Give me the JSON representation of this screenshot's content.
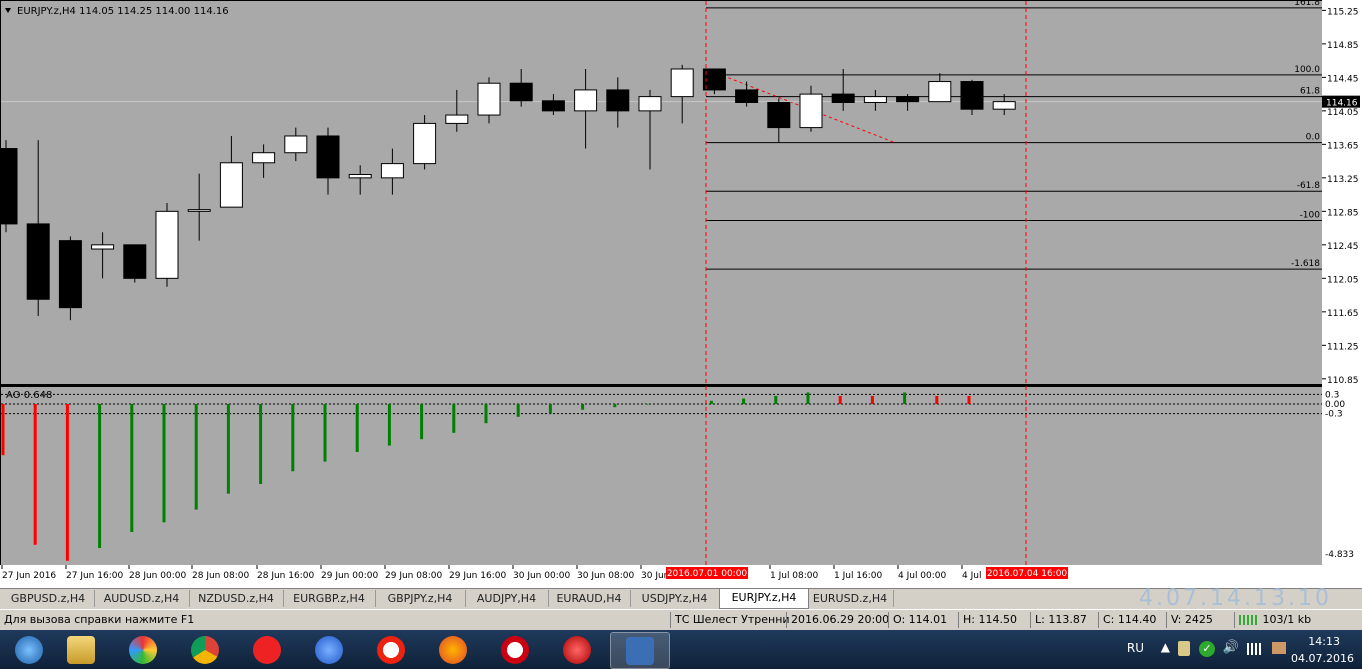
{
  "chart": {
    "symbol_header": "EURJPY.z,H4  114.05 114.25 114.00 114.16",
    "indicator_label": "AO 0.648",
    "current_price_tag": "114.16",
    "price_axis": [
      "115.25",
      "114.85",
      "114.45",
      "114.05",
      "113.65",
      "113.25",
      "112.85",
      "112.45",
      "112.05",
      "111.65",
      "111.25",
      "110.85"
    ],
    "ao_axis": [
      "0.3",
      "0.00",
      "-0.3",
      "-4.833"
    ],
    "fib_levels": [
      {
        "label": "161.8",
        "price": 115.28
      },
      {
        "label": "100.0",
        "price": 114.48
      },
      {
        "label": "61.8",
        "price": 114.22
      },
      {
        "label": "0.0",
        "price": 113.67
      },
      {
        "label": "-61.8",
        "price": 113.09
      },
      {
        "label": "-100",
        "price": 112.74
      },
      {
        "label": "-1.618",
        "price": 112.16
      }
    ],
    "time_labels": [
      "27 Jun 2016",
      "27 Jun 16:00",
      "28 Jun 00:00",
      "28 Jun 08:00",
      "28 Jun 16:00",
      "29 Jun 00:00",
      "29 Jun 08:00",
      "29 Jun 16:00",
      "30 Jun 00:00",
      "30 Jun 08:00",
      "30 Jun",
      "1 Jul 08:00",
      "1 Jul 16:00",
      "4 Jul 00:00",
      "4 Jul"
    ],
    "vline_labels": [
      "2016.07.01 00:00",
      "2016.07.04 16:00"
    ],
    "colors": {
      "background": "#a9a9a9",
      "bull": "#ffffff",
      "bear": "#000000",
      "ao_up": "#008000",
      "ao_down": "#ff0000",
      "vline": "#ff0000"
    }
  },
  "chart_data": {
    "type": "candlestick",
    "ylim": [
      110.8,
      115.35
    ],
    "candles": [
      {
        "o": 113.6,
        "h": 113.7,
        "l": 112.6,
        "c": 112.7
      },
      {
        "o": 112.7,
        "h": 113.7,
        "l": 111.6,
        "c": 111.8
      },
      {
        "o": 112.5,
        "h": 112.55,
        "l": 111.55,
        "c": 111.7
      },
      {
        "o": 112.4,
        "h": 112.6,
        "l": 112.05,
        "c": 112.45
      },
      {
        "o": 112.45,
        "h": 112.45,
        "l": 112.0,
        "c": 112.05
      },
      {
        "o": 112.05,
        "h": 112.95,
        "l": 111.95,
        "c": 112.85
      },
      {
        "o": 112.85,
        "h": 113.3,
        "l": 112.5,
        "c": 112.87
      },
      {
        "o": 112.9,
        "h": 113.75,
        "l": 112.9,
        "c": 113.43
      },
      {
        "o": 113.43,
        "h": 113.65,
        "l": 113.25,
        "c": 113.55
      },
      {
        "o": 113.55,
        "h": 113.85,
        "l": 113.45,
        "c": 113.75
      },
      {
        "o": 113.75,
        "h": 113.85,
        "l": 113.05,
        "c": 113.25
      },
      {
        "o": 113.25,
        "h": 113.4,
        "l": 113.05,
        "c": 113.29
      },
      {
        "o": 113.25,
        "h": 113.6,
        "l": 113.05,
        "c": 113.42
      },
      {
        "o": 113.42,
        "h": 114.0,
        "l": 113.35,
        "c": 113.9
      },
      {
        "o": 113.9,
        "h": 114.3,
        "l": 113.8,
        "c": 114.0
      },
      {
        "o": 114.0,
        "h": 114.45,
        "l": 113.9,
        "c": 114.38
      },
      {
        "o": 114.38,
        "h": 114.55,
        "l": 114.1,
        "c": 114.17
      },
      {
        "o": 114.17,
        "h": 114.25,
        "l": 114.0,
        "c": 114.05
      },
      {
        "o": 114.05,
        "h": 114.55,
        "l": 113.6,
        "c": 114.3
      },
      {
        "o": 114.3,
        "h": 114.45,
        "l": 113.85,
        "c": 114.05
      },
      {
        "o": 114.05,
        "h": 114.3,
        "l": 113.35,
        "c": 114.22
      },
      {
        "o": 114.22,
        "h": 114.6,
        "l": 113.9,
        "c": 114.55
      },
      {
        "o": 114.55,
        "h": 114.55,
        "l": 114.25,
        "c": 114.3
      },
      {
        "o": 114.3,
        "h": 114.4,
        "l": 114.1,
        "c": 114.15
      },
      {
        "o": 114.15,
        "h": 114.2,
        "l": 113.67,
        "c": 113.85
      },
      {
        "o": 113.85,
        "h": 114.35,
        "l": 113.8,
        "c": 114.25
      },
      {
        "o": 114.25,
        "h": 114.55,
        "l": 114.05,
        "c": 114.15
      },
      {
        "o": 114.15,
        "h": 114.3,
        "l": 114.05,
        "c": 114.22
      },
      {
        "o": 114.22,
        "h": 114.25,
        "l": 114.05,
        "c": 114.16
      },
      {
        "o": 114.16,
        "h": 114.5,
        "l": 114.2,
        "c": 114.4
      },
      {
        "o": 114.4,
        "h": 114.42,
        "l": 114.0,
        "c": 114.07
      },
      {
        "o": 114.07,
        "h": 114.25,
        "l": 114.0,
        "c": 114.16
      }
    ],
    "ao_values": [
      -1.6,
      -4.4,
      -4.9,
      -4.5,
      -4.0,
      -3.7,
      -3.3,
      -2.8,
      -2.5,
      -2.1,
      -1.8,
      -1.5,
      -1.3,
      -1.1,
      -0.9,
      -0.6,
      -0.4,
      -0.3,
      -0.18,
      -0.1,
      -0.02,
      0,
      0.1,
      0.17,
      0.25,
      0.36,
      0.25,
      0.25,
      0.36,
      0.25,
      0.25,
      0
    ],
    "ao_colors": [
      "d",
      "d",
      "d",
      "u",
      "u",
      "u",
      "u",
      "u",
      "u",
      "u",
      "u",
      "u",
      "u",
      "u",
      "u",
      "u",
      "u",
      "u",
      "u",
      "u",
      "u",
      "u",
      "u",
      "u",
      "u",
      "u",
      "d",
      "d",
      "u",
      "d",
      "d",
      "n"
    ],
    "ao_ylim": [
      -5.0,
      0.5
    ]
  },
  "tabs": [
    "GBPUSD.z,H4",
    "AUDUSD.z,H4",
    "NZDUSD.z,H4",
    "EURGBP.z,H4",
    "GBPJPY.z,H4",
    "AUDJPY,H4",
    "EURAUD,H4",
    "USDJPY.z,H4",
    "EURJPY.z,H4",
    "EURUSD.z,H4"
  ],
  "active_tab": "EURJPY.z,H4",
  "watermark": "4.07.14.13.10",
  "status": {
    "help": "Для вызова справки нажмите F1",
    "profile": "ТС Шелест Утренни",
    "datetime": "2016.06.29 20:00",
    "open": "O: 114.01",
    "high": "H: 114.50",
    "low": "L: 113.87",
    "close": "C: 114.40",
    "volume": "V: 2425",
    "traffic": "103/1 kb"
  },
  "taskbar": {
    "lang": "RU",
    "time": "14:13",
    "date": "04.07.2016",
    "apps": [
      "start-orb-icon",
      "file-explorer-icon",
      "color-app-icon",
      "chrome-icon",
      "yandex-browser-icon",
      "chromium-icon",
      "opera-icon",
      "firefox-icon",
      "opera-alt-icon",
      "red-app-icon",
      "metatrader-icon"
    ]
  }
}
